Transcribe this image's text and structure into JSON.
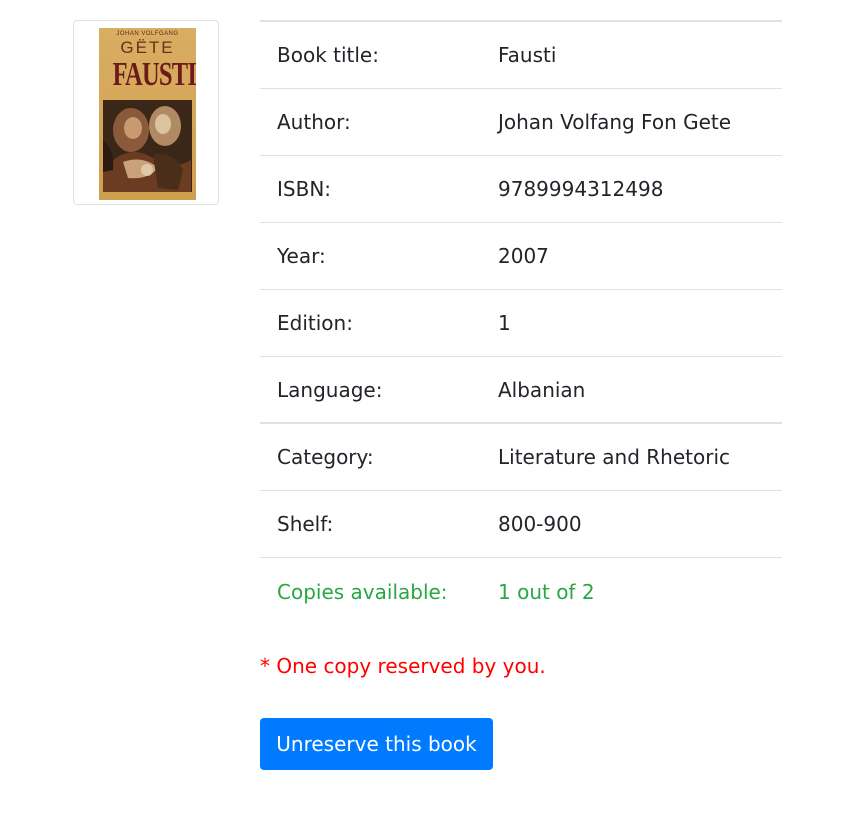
{
  "book": {
    "cover": {
      "author_line": "JOHAN VOLFGANG",
      "author_name": "GËTE",
      "title": "FAUSTI"
    },
    "details": [
      {
        "label": "Book title:",
        "value": "Fausti"
      },
      {
        "label": "Author:",
        "value": "Johan Volfang Fon Gete"
      },
      {
        "label": "ISBN:",
        "value": "9789994312498"
      },
      {
        "label": "Year:",
        "value": "2007"
      },
      {
        "label": "Edition:",
        "value": "1"
      },
      {
        "label": "Language:",
        "value": "Albanian"
      },
      {
        "label": "Category:",
        "value": "Literature and Rhetoric"
      },
      {
        "label": "Shelf:",
        "value": "800-900"
      },
      {
        "label": "Copies available:",
        "value": "1 out of 2"
      }
    ]
  },
  "reservation_note": "* One copy reserved by you.",
  "actions": {
    "unreserve_label": "Unreserve this book"
  },
  "colors": {
    "available_green": "#28a745",
    "note_red": "#ff0000",
    "button_blue": "#007bff",
    "border": "#dee2e6"
  }
}
